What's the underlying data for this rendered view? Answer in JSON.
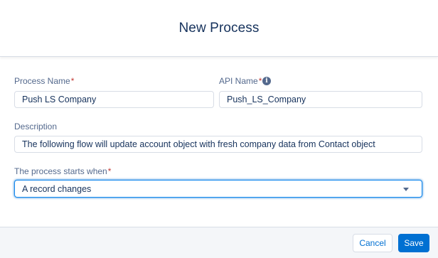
{
  "header": {
    "title": "New Process"
  },
  "form": {
    "process_name": {
      "label": "Process Name",
      "required_mark": "*",
      "value": "Push LS Company"
    },
    "api_name": {
      "label": "API Name",
      "required_mark": "*",
      "value": "Push_LS_Company",
      "info_icon": "info-icon"
    },
    "description": {
      "label": "Description",
      "value": "The following flow will update account object with fresh company data from Contact object"
    },
    "starts_when": {
      "label": "The process starts when",
      "required_mark": "*",
      "value": "A record changes"
    }
  },
  "footer": {
    "cancel_label": "Cancel",
    "save_label": "Save"
  },
  "colors": {
    "accent": "#0070d2",
    "required": "#c23934",
    "label": "#54698d",
    "text": "#16325c"
  }
}
